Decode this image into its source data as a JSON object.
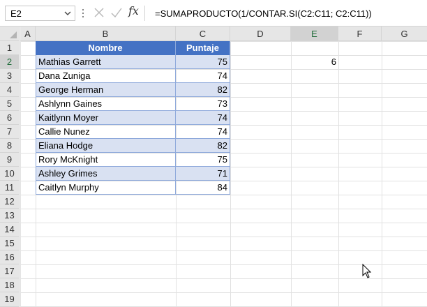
{
  "formula_bar": {
    "name_box": "E2",
    "fx_label": "fx",
    "formula": "=SUMAPRODUCTO(1/CONTAR.SI(C2:C11; C2:C11))"
  },
  "columns": [
    "A",
    "B",
    "C",
    "D",
    "E",
    "F",
    "G"
  ],
  "rows": [
    "1",
    "2",
    "3",
    "4",
    "5",
    "6",
    "7",
    "8",
    "9",
    "10",
    "11",
    "12",
    "13",
    "14",
    "15",
    "16",
    "17",
    "18",
    "19"
  ],
  "table": {
    "headers": {
      "name": "Nombre",
      "score": "Puntaje"
    },
    "rows": [
      {
        "name": "Mathias Garrett",
        "score": "75"
      },
      {
        "name": "Dana Zuniga",
        "score": "74"
      },
      {
        "name": "George Herman",
        "score": "82"
      },
      {
        "name": "Ashlynn Gaines",
        "score": "73"
      },
      {
        "name": "Kaitlynn Moyer",
        "score": "74"
      },
      {
        "name": "Callie Nunez",
        "score": "74"
      },
      {
        "name": "Eliana Hodge",
        "score": "82"
      },
      {
        "name": "Rory McKnight",
        "score": "75"
      },
      {
        "name": "Ashley Grimes",
        "score": "71"
      },
      {
        "name": "Caitlyn Murphy",
        "score": "84"
      }
    ],
    "header_color": "#4472c4",
    "band_color": "#d9e1f2"
  },
  "result_cell": {
    "address": "E2",
    "value": "6"
  },
  "icons": {
    "name_box_dropdown": "chevron-down-icon",
    "cancel": "close-icon",
    "enter": "check-icon",
    "function": "function-icon",
    "cursor": "mouse-pointer-icon"
  }
}
